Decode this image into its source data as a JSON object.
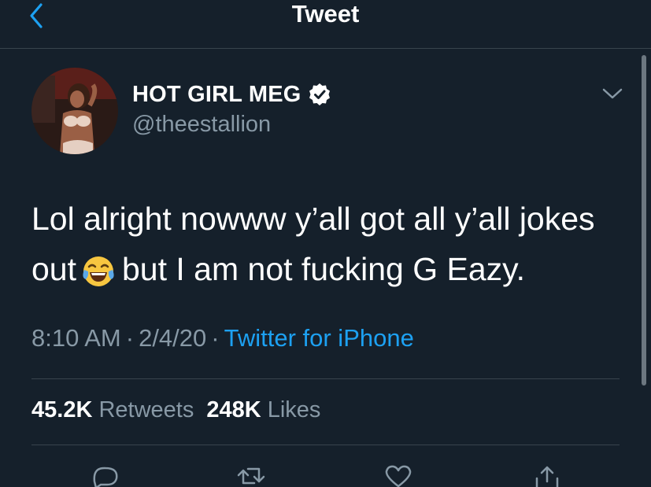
{
  "header": {
    "title": "Tweet",
    "back_icon": "chevron-left-icon"
  },
  "author": {
    "display_name": "HOT GIRL MEG",
    "handle": "@theestallion",
    "verified_icon": "verified-badge-icon"
  },
  "tweet": {
    "text_line1": "Lol alright nowww y’all got all y’all jokes",
    "text_line2_before": "out",
    "emoji": "face-with-tears-of-joy-icon",
    "text_line2_after": "but I am not fucking G Eazy."
  },
  "meta": {
    "time": "8:10 AM",
    "sep1": "·",
    "date": "2/4/20",
    "sep2": "·",
    "source": "Twitter for iPhone"
  },
  "stats": {
    "retweets_count": "45.2K",
    "retweets_label": "Retweets",
    "likes_count": "248K",
    "likes_label": "Likes"
  },
  "actions": [
    "reply-icon",
    "retweet-icon",
    "like-icon",
    "share-icon"
  ],
  "colors": {
    "background": "#15202b",
    "accent": "#1da1f2",
    "secondary_text": "#8899a6",
    "divider": "#38444d"
  }
}
